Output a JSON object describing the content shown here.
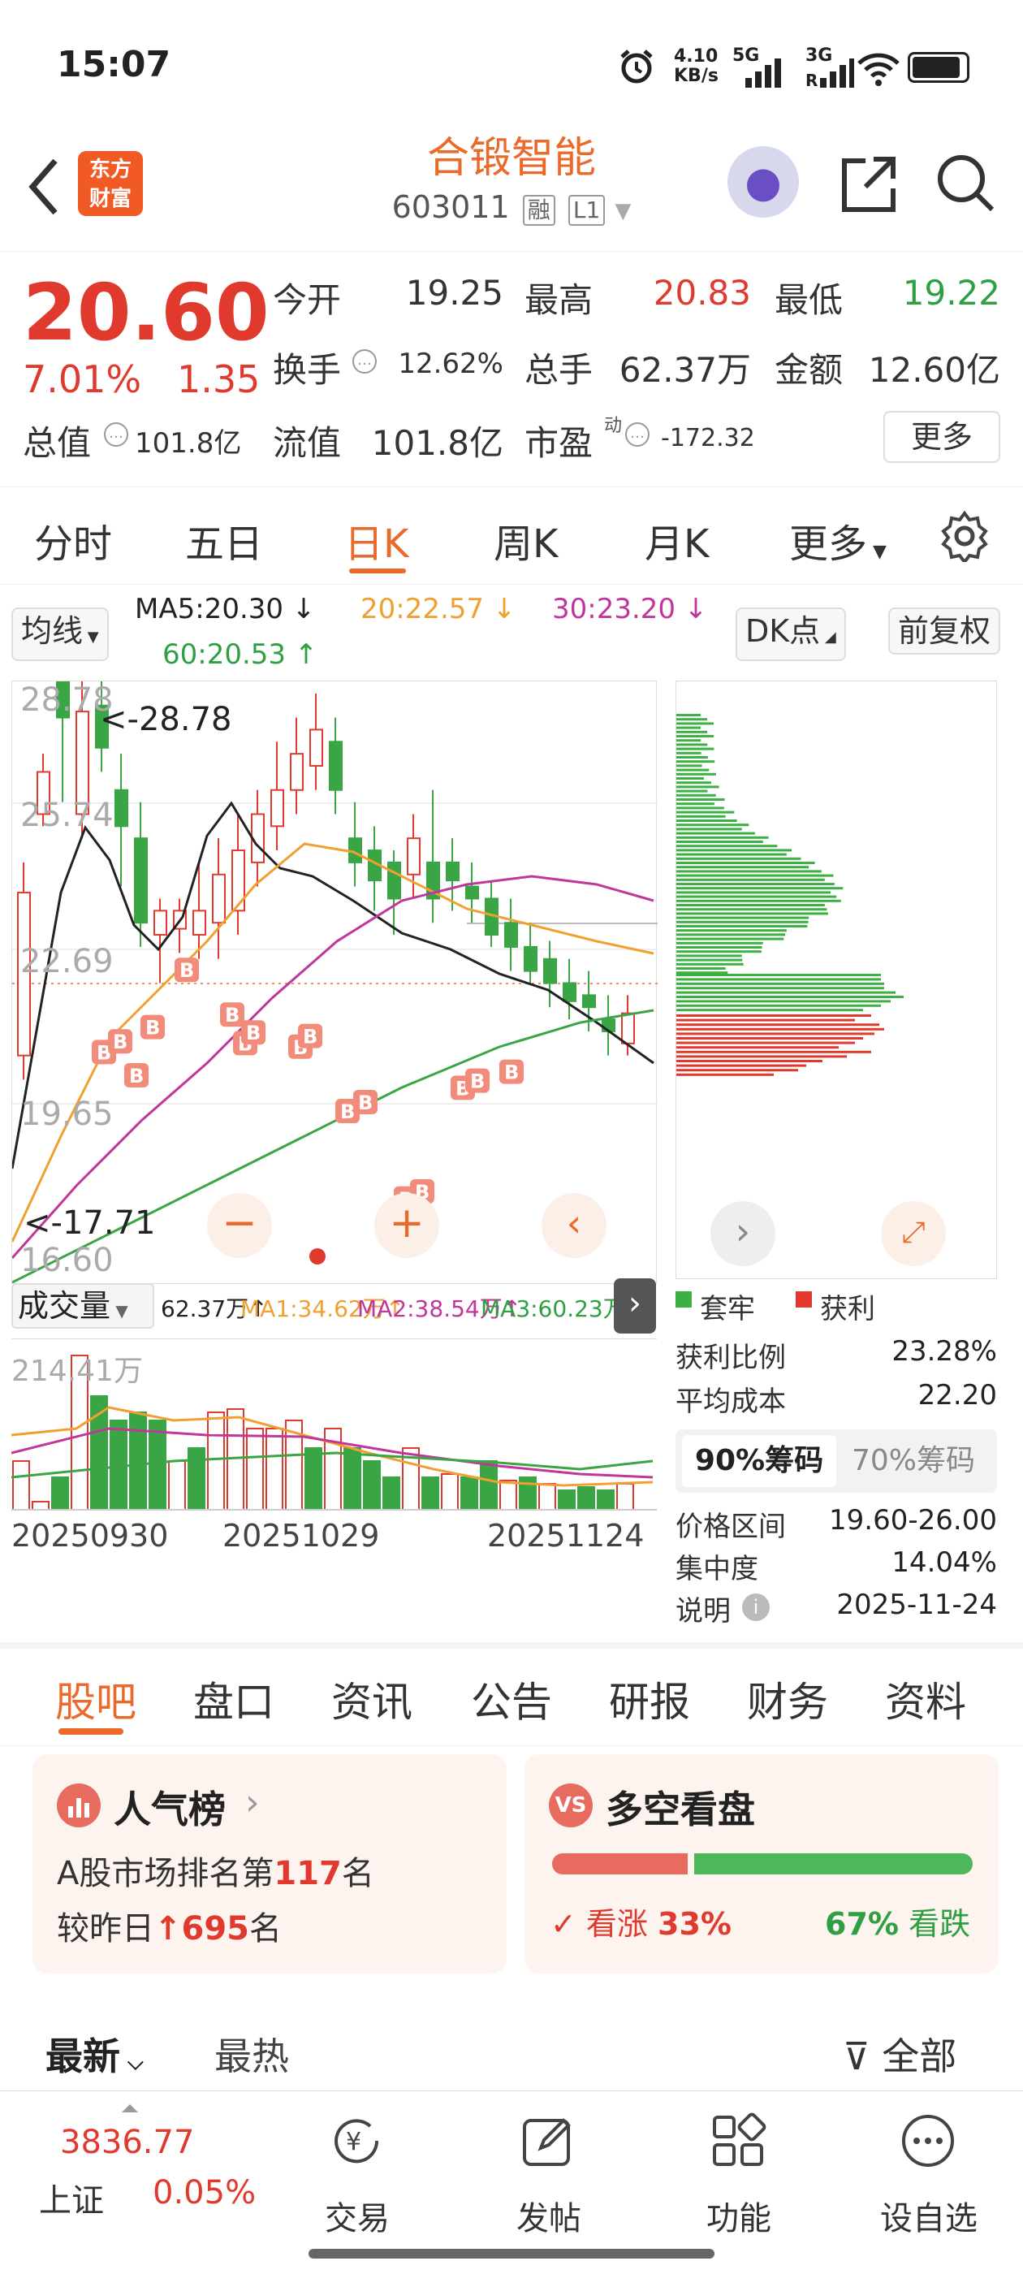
{
  "status": {
    "time": "15:07",
    "speed": "4.10\nKB/s",
    "net1": "5G",
    "net2": "3G"
  },
  "header": {
    "logo_line1": "东方",
    "logo_line2": "财富",
    "name": "合锻智能",
    "code": "603011",
    "tag1": "融",
    "tag2": "L1"
  },
  "quote": {
    "price": "20.60",
    "pct": "7.01%",
    "change": "1.35",
    "open_label": "今开",
    "open": "19.25",
    "high_label": "最高",
    "high": "20.83",
    "low_label": "最低",
    "low": "19.22",
    "turnover_label": "换手",
    "turnover": "12.62%",
    "volume_label": "总手",
    "volume": "62.37万",
    "amount_label": "金额",
    "amount": "12.60亿",
    "mktcap_label": "总值",
    "mktcap": "101.8亿",
    "float_label": "流值",
    "float": "101.8亿",
    "pe_label": "市盈",
    "pe_sup": "动",
    "pe": "-172.32",
    "more": "更多"
  },
  "ktabs": [
    "分时",
    "五日",
    "日K",
    "周K",
    "月K",
    "更多"
  ],
  "ma": {
    "type": "均线",
    "ma5": "MA5:20.30 ↓",
    "ma20": "20:22.57 ↓",
    "ma30": "30:23.20 ↓",
    "ma60": "60:20.53 ↑",
    "dk": "DK点",
    "adj": "前复权"
  },
  "kchart": {
    "y_labels": [
      "28.78",
      "25.74",
      "22.69",
      "19.65",
      "16.60"
    ],
    "max_note": "<-28.78",
    "min_note": "<-17.71",
    "b_mark": "B"
  },
  "volume": {
    "label": "成交量",
    "vol": "62.37万↑",
    "ma1": "MA1:34.62万↑",
    "ma2": "MA2:38.54万↑",
    "ma3": "MA3:60.23万↓",
    "ymax": "214.41万",
    "dates": [
      "20250930",
      "20251029",
      "20251124"
    ]
  },
  "chips": {
    "legend_trap": "套牢",
    "legend_profit": "获利",
    "profit_ratio_label": "获利比例",
    "profit_ratio": "23.28%",
    "avg_cost_label": "平均成本",
    "avg_cost": "22.20",
    "seg90": "90%筹码",
    "seg70": "70%筹码",
    "range_label": "价格区间",
    "range": "19.60-26.00",
    "conc_label": "集中度",
    "conc": "14.04%",
    "note_label": "说明",
    "note": "2025-11-24"
  },
  "ctabs": [
    "股吧",
    "盘口",
    "资讯",
    "公告",
    "研报",
    "财务",
    "资料"
  ],
  "popular": {
    "title": "人气榜",
    "line1_pre": "A股市场排名第",
    "rank": "117",
    "line1_post": "名",
    "line2_pre": "较昨日",
    "delta": "695",
    "line2_post": "名"
  },
  "bullbear": {
    "title": "多空看盘",
    "bull_label": "看涨",
    "bull": "33%",
    "bear": "67%",
    "bear_label": "看跌",
    "bull_frac": 0.33
  },
  "feed": {
    "latest": "最新",
    "hot": "最热",
    "filter": "全部"
  },
  "nav": {
    "index_value": "3836.77",
    "index_name": "上证",
    "index_pct": "0.05%",
    "trade": "交易",
    "post": "发帖",
    "func": "功能",
    "watch": "设自选"
  }
}
